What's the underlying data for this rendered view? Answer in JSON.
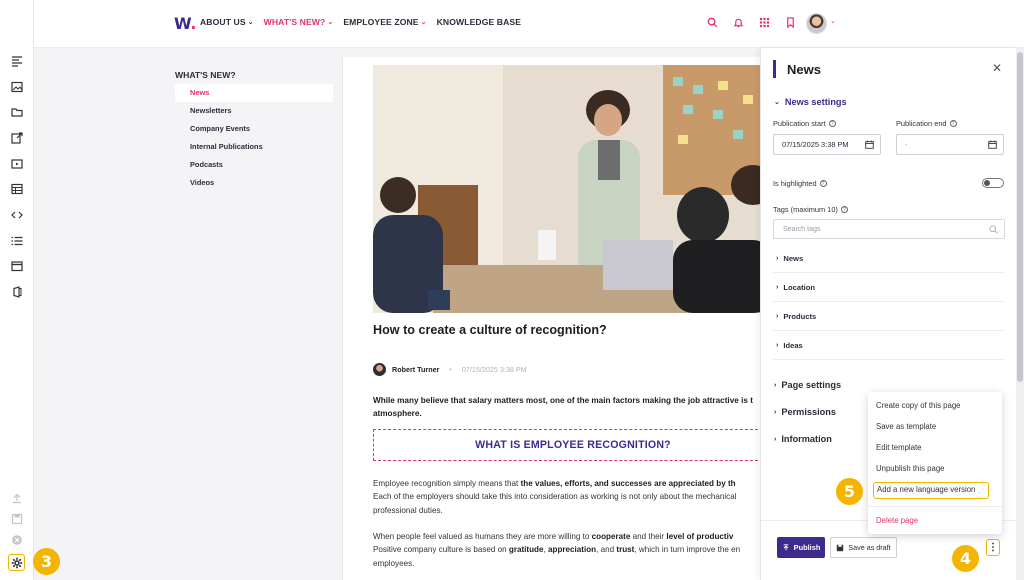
{
  "header": {
    "logo": "W",
    "nav": [
      {
        "label": "ABOUT US",
        "has_menu": true
      },
      {
        "label": "WHAT'S NEW?",
        "has_menu": true,
        "active": true
      },
      {
        "label": "EMPLOYEE ZONE",
        "has_menu": true
      },
      {
        "label": "KNOWLEDGE BASE",
        "has_menu": false
      }
    ],
    "icons": [
      "search-icon",
      "bell-icon",
      "apps-grid-icon",
      "bookmark-icon"
    ]
  },
  "subnav": {
    "title": "WHAT'S NEW?",
    "items": [
      "News",
      "Newsletters",
      "Company Events",
      "Internal Publications",
      "Podcasts",
      "Videos"
    ]
  },
  "article": {
    "title": "How to create a culture of recognition?",
    "author": "Robert Turner",
    "date": "07/15/2025 3:38 PM",
    "lead": "While many believe that salary matters most, one of the main factors making the job attractive is t",
    "lead_2": "atmosphere.",
    "callout": "WHAT IS EMPLOYEE RECOGNITION?",
    "p1_a": "Employee recognition simply means that ",
    "p1_b": "the values, efforts, and successes are appreciated by th",
    "p1_line2": "Each of the employers should take this into consideration as working is not only about the mechanical",
    "p1_line3": "professional duties.",
    "p2_a": "When people feel valued as humans they are more willing to ",
    "p2_b": "cooperate",
    "p2_c": " and their ",
    "p2_d": "level of productiv",
    "p2_line2_a": "Positive company culture is based on ",
    "p2_line2_b": "gratitude",
    "p2_line2_c": ", ",
    "p2_line2_d": "appreciation",
    "p2_line2_e": ", and ",
    "p2_line2_f": "trust",
    "p2_line2_g": ", which in turn improve the en",
    "p2_line3": "employees."
  },
  "panel": {
    "title": "News",
    "news_settings": "News settings",
    "publication_start_label": "Publication start",
    "publication_start_value": "07/15/2025 3:38 PM",
    "publication_end_label": "Publication end",
    "publication_end_value": "-",
    "highlighted_label": "Is highlighted",
    "highlighted": false,
    "tags_label": "Tags (maximum 10)",
    "tags_placeholder": "Search tags",
    "tag_groups": [
      "News",
      "Location",
      "Products",
      "Ideas"
    ],
    "sections": [
      "Page settings",
      "Permissions",
      "Information"
    ],
    "publish_label": "Publish",
    "draft_label": "Save as draft"
  },
  "menu": {
    "items": [
      "Create copy of this page",
      "Save as template",
      "Edit template",
      "Unpublish this page",
      "Add a new language version"
    ],
    "danger_item": "Delete page"
  },
  "badges": [
    "3",
    "4",
    "5"
  ],
  "colors": {
    "brand": "#3d2a8c",
    "accent": "#e0336b",
    "highlight": "#f4b400"
  }
}
